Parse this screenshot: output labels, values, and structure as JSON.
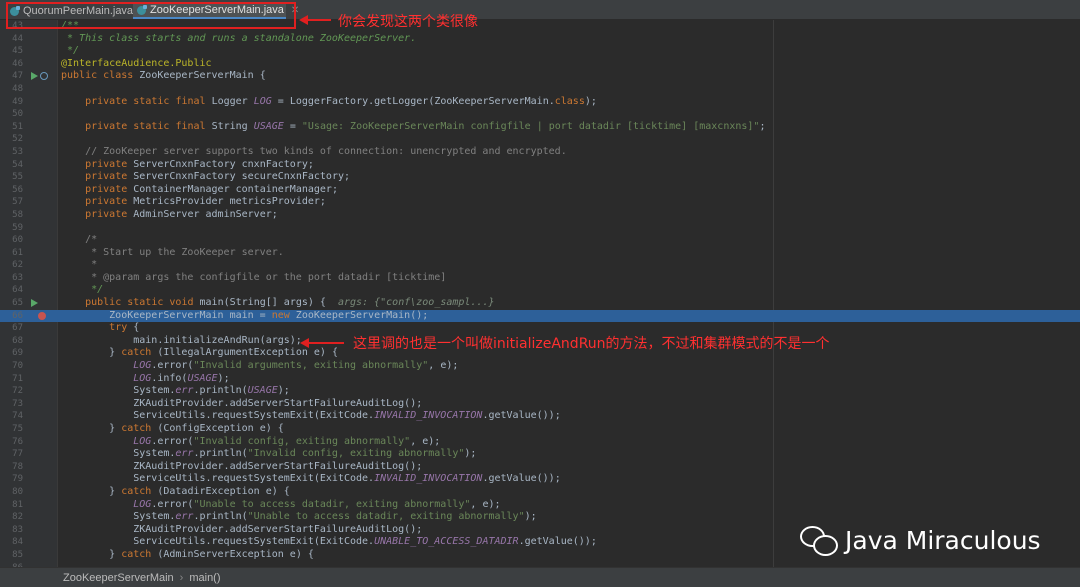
{
  "tabs": [
    {
      "label": "QuorumPeerMain.java",
      "active": false
    },
    {
      "label": "ZooKeeperServerMain.java",
      "active": true
    }
  ],
  "annotations": {
    "tabs_note": "你会发现这两个类很像",
    "code_note": "这里调的也是一个叫做initializeAndRun的方法，不过和集群模式的不是一个"
  },
  "code": {
    "highlighted_line": 66,
    "lines": [
      {
        "n": "43",
        "t": "/**"
      },
      {
        "n": "44",
        "t": " * This class starts and runs a standalone ZooKeeperServer."
      },
      {
        "n": "45",
        "t": " */"
      },
      {
        "n": "46",
        "t": "@InterfaceAudience.Public"
      },
      {
        "n": "47",
        "t": "public class ZooKeeperServerMain {"
      },
      {
        "n": "48",
        "t": ""
      },
      {
        "n": "49",
        "t": "    private static final Logger LOG = LoggerFactory.getLogger(ZooKeeperServerMain.class);"
      },
      {
        "n": "50",
        "t": ""
      },
      {
        "n": "51",
        "t": "    private static final String USAGE = \"Usage: ZooKeeperServerMain configfile | port datadir [ticktime] [maxcnxns]\";"
      },
      {
        "n": "52",
        "t": ""
      },
      {
        "n": "53",
        "t": "    // ZooKeeper server supports two kinds of connection: unencrypted and encrypted."
      },
      {
        "n": "54",
        "t": "    private ServerCnxnFactory cnxnFactory;"
      },
      {
        "n": "55",
        "t": "    private ServerCnxnFactory secureCnxnFactory;"
      },
      {
        "n": "56",
        "t": "    private ContainerManager containerManager;"
      },
      {
        "n": "57",
        "t": "    private MetricsProvider metricsProvider;"
      },
      {
        "n": "58",
        "t": "    private AdminServer adminServer;"
      },
      {
        "n": "59",
        "t": ""
      },
      {
        "n": "60",
        "t": "    /*"
      },
      {
        "n": "61",
        "t": "     * Start up the ZooKeeper server."
      },
      {
        "n": "62",
        "t": "     *"
      },
      {
        "n": "63",
        "t": "     * @param args the configfile or the port datadir [ticktime]"
      },
      {
        "n": "64",
        "t": "     */"
      },
      {
        "n": "65",
        "t": "    public static void main(String[] args) {  args: {\"conf\\zoo_sampl...}"
      },
      {
        "n": "66",
        "t": "        ZooKeeperServerMain main = new ZooKeeperServerMain();"
      },
      {
        "n": "67",
        "t": "        try {"
      },
      {
        "n": "68",
        "t": "            main.initializeAndRun(args);"
      },
      {
        "n": "69",
        "t": "        } catch (IllegalArgumentException e) {"
      },
      {
        "n": "70",
        "t": "            LOG.error(\"Invalid arguments, exiting abnormally\", e);"
      },
      {
        "n": "71",
        "t": "            LOG.info(USAGE);"
      },
      {
        "n": "72",
        "t": "            System.err.println(USAGE);"
      },
      {
        "n": "73",
        "t": "            ZKAuditProvider.addServerStartFailureAuditLog();"
      },
      {
        "n": "74",
        "t": "            ServiceUtils.requestSystemExit(ExitCode.INVALID_INVOCATION.getValue());"
      },
      {
        "n": "75",
        "t": "        } catch (ConfigException e) {"
      },
      {
        "n": "76",
        "t": "            LOG.error(\"Invalid config, exiting abnormally\", e);"
      },
      {
        "n": "77",
        "t": "            System.err.println(\"Invalid config, exiting abnormally\");"
      },
      {
        "n": "78",
        "t": "            ZKAuditProvider.addServerStartFailureAuditLog();"
      },
      {
        "n": "79",
        "t": "            ServiceUtils.requestSystemExit(ExitCode.INVALID_INVOCATION.getValue());"
      },
      {
        "n": "80",
        "t": "        } catch (DatadirException e) {"
      },
      {
        "n": "81",
        "t": "            LOG.error(\"Unable to access datadir, exiting abnormally\", e);"
      },
      {
        "n": "82",
        "t": "            System.err.println(\"Unable to access datadir, exiting abnormally\");"
      },
      {
        "n": "83",
        "t": "            ZKAuditProvider.addServerStartFailureAuditLog();"
      },
      {
        "n": "84",
        "t": "            ServiceUtils.requestSystemExit(ExitCode.UNABLE_TO_ACCESS_DATADIR.getValue());"
      },
      {
        "n": "85",
        "t": "        } catch (AdminServerException e) {"
      },
      {
        "n": "86",
        "t": ""
      }
    ]
  },
  "statusbar": {
    "class_name": "ZooKeeperServerMain",
    "method_name": "main()"
  },
  "watermark": {
    "text": "Java Miraculous"
  },
  "colors": {
    "annotation": "#e02020",
    "highlight": "#2d6099",
    "keyword": "#cc7832",
    "string": "#6a8759"
  }
}
